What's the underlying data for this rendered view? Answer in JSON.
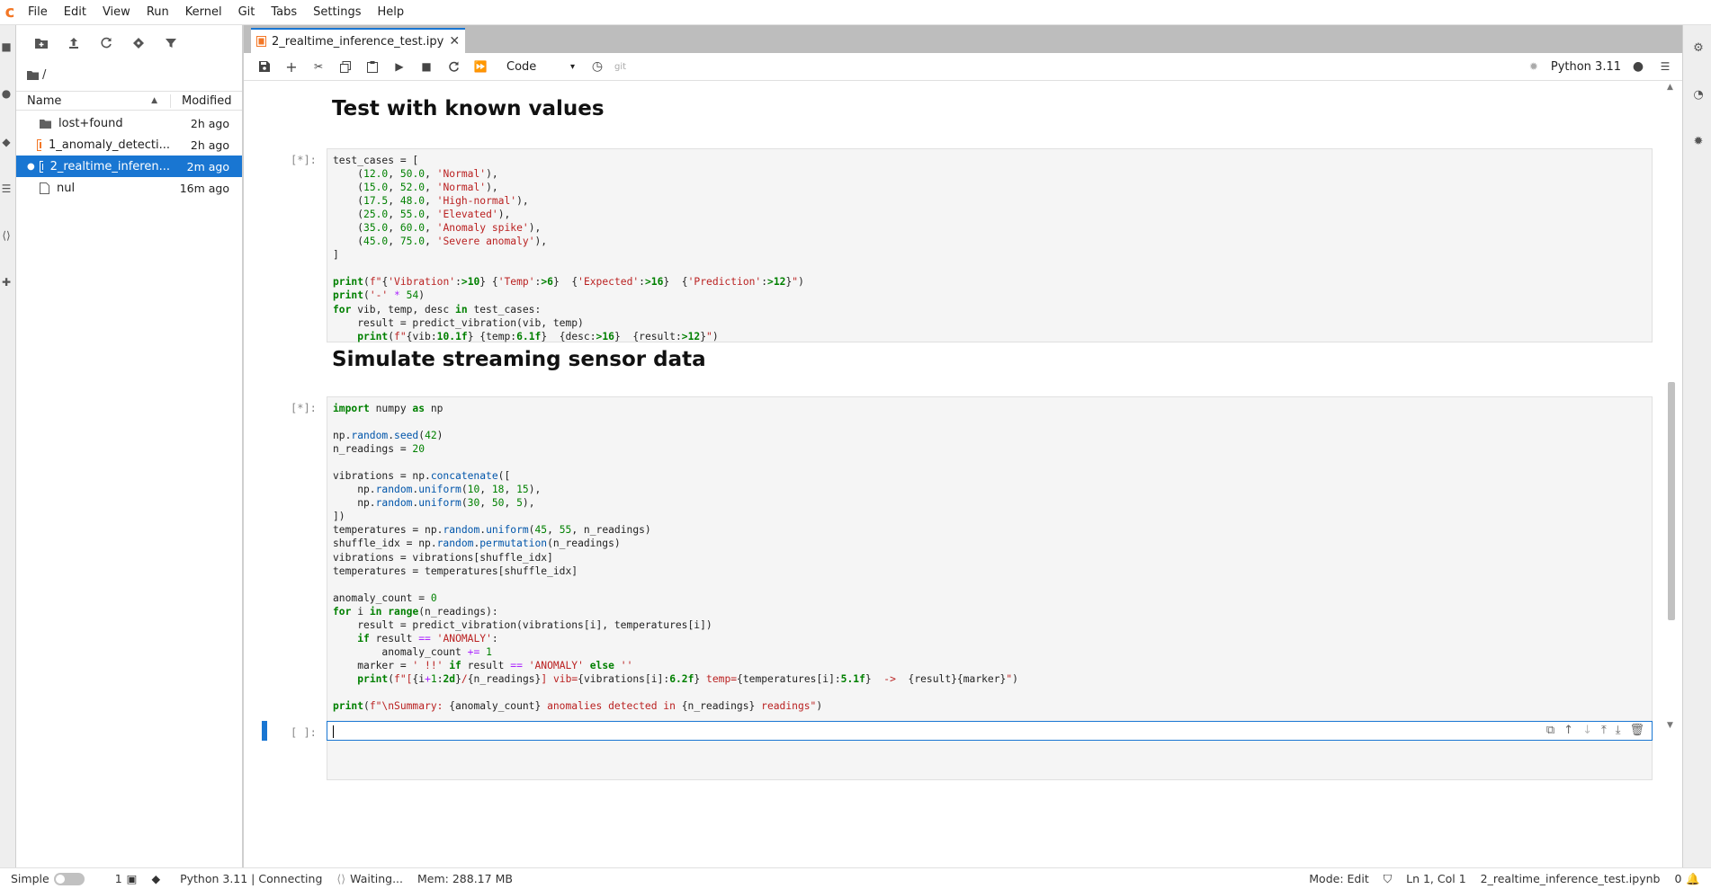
{
  "menubar": {
    "items": [
      "File",
      "Edit",
      "View",
      "Run",
      "Kernel",
      "Git",
      "Tabs",
      "Settings",
      "Help"
    ]
  },
  "filebrowser": {
    "path": "/",
    "columns": {
      "name": "Name",
      "modified": "Modified"
    },
    "files": [
      {
        "name": "lost+found",
        "modified": "2h ago",
        "icon": "folder-icon",
        "selected": false
      },
      {
        "name": "1_anomaly_detecti...",
        "modified": "2h ago",
        "icon": "notebook-icon",
        "selected": false
      },
      {
        "name": "2_realtime_inferen...",
        "modified": "2m ago",
        "icon": "notebook-icon",
        "selected": true
      },
      {
        "name": "nul",
        "modified": "16m ago",
        "icon": "file-icon",
        "selected": false
      }
    ]
  },
  "tab": {
    "label": "2_realtime_inference_test.ipy"
  },
  "toolbar": {
    "cell_type": "Code",
    "git_label": "git",
    "kernel_name": "Python 3.11"
  },
  "cells": {
    "heading1": "Test with known values",
    "prompt1": "[*]:",
    "heading2": "Simulate streaming sensor data",
    "prompt2": "[*]:",
    "prompt3": "[ ]:"
  },
  "statusbar": {
    "mode_simple": "Simple",
    "terminals": "1",
    "kernel_status": "Python 3.11 | Connecting",
    "waiting": "Waiting...",
    "memory": "Mem: 288.17 MB",
    "mode": "Mode: Edit",
    "cursor": "Ln 1, Col 1",
    "filename": "2_realtime_inference_test.ipynb",
    "notifications": "0"
  },
  "colors": {
    "accent": "#1976d2",
    "brand": "#f37726"
  }
}
